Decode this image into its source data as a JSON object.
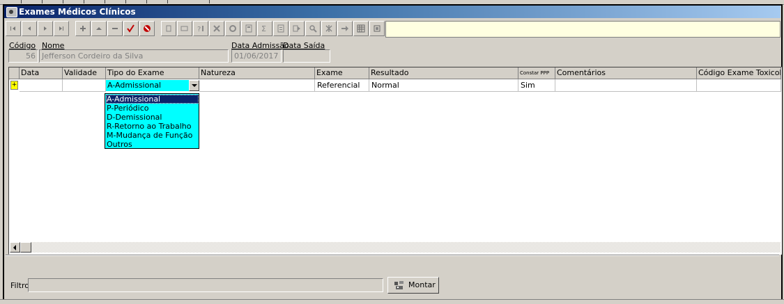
{
  "window": {
    "title": "Exames Médicos Clínicos"
  },
  "toolbar": {
    "buttons": [
      {
        "name": "first-record-icon"
      },
      {
        "name": "prior-record-icon"
      },
      {
        "name": "next-record-icon"
      },
      {
        "name": "last-record-icon"
      },
      {
        "name": "insert-icon"
      },
      {
        "name": "edit-icon"
      },
      {
        "name": "delete-icon"
      },
      {
        "name": "post-check-icon"
      },
      {
        "name": "cancel-icon"
      },
      {
        "name": "print-icon"
      },
      {
        "name": "view-icon"
      },
      {
        "name": "help-query-icon"
      },
      {
        "name": "tools-icon"
      },
      {
        "name": "settings-icon"
      },
      {
        "name": "calculator-icon"
      },
      {
        "name": "sum-icon"
      },
      {
        "name": "report-icon"
      },
      {
        "name": "export-icon"
      },
      {
        "name": "search-icon"
      },
      {
        "name": "filter-icon"
      },
      {
        "name": "transfer-icon"
      },
      {
        "name": "grid-icon"
      },
      {
        "name": "close-icon"
      }
    ]
  },
  "header": {
    "codigo_label": "Código",
    "codigo_value": "56",
    "nome_label": "Nome",
    "nome_value": "Jefferson Cordeiro da Silva",
    "admissao_label": "Data Admissão",
    "admissao_value": "01/06/2017",
    "saida_label": "Data Saída",
    "saida_value": ""
  },
  "grid": {
    "columns": [
      "Data",
      "Validade",
      "Tipo do Exame",
      "Natureza",
      "Exame",
      "Resultado",
      "Constar PPP",
      "Comentários",
      "Código Exame Toxicológico"
    ],
    "row": {
      "indicator": "+",
      "data": "",
      "validade": "",
      "tipo": "A-Admissional",
      "natureza": "",
      "exame": "Referencial",
      "resultado": "Normal",
      "constar_ppp": "Sim",
      "comentarios": "",
      "codigo_tox": ""
    }
  },
  "dropdown": {
    "selected": "A-Admissional",
    "options": [
      "A-Admissional",
      "P-Periódico",
      "D-Demissional",
      "R-Retorno ao Trabalho",
      "M-Mudança de Função",
      "Outros"
    ]
  },
  "filter": {
    "label": "Filtro",
    "value": ""
  },
  "montar_button": {
    "label": "Montar"
  },
  "colors": {
    "titlebar": "#0a246a",
    "dropdown_bg": "#00ffff",
    "indicator": "#ffff00",
    "toolbar_field": "#ffffe1"
  }
}
